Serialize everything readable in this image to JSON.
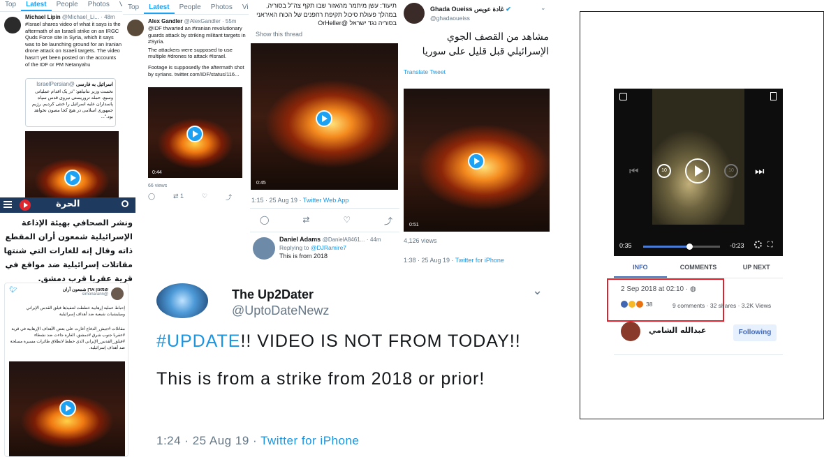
{
  "panel1": {
    "tabs": [
      "Top",
      "Latest",
      "People",
      "Photos",
      "Videos"
    ],
    "active_tab": "Latest",
    "author_name": "Michael Lipin",
    "author_handle": "@Michael_Li...",
    "time": "48m",
    "body": "#Israel shares video of what it says is the aftermath of an Israeli strike on an IRGC Quds Force site in Syria, which it says was to be launching ground for an Iranian drone attack on Israeli targets. The video hasn't yet been posted on the accounts of the IDF or PM Netanyahu",
    "quoted_name": "اسرائیل به فارسی",
    "quoted_handle": "@IsraelPersian",
    "quoted_body": "نخست وزیر نتانیاهو: \"در یک اقدام عملیاتی وسیع، حمله تروریستی نیروی قدس سپاه پاسداران علیه اسرائیل را خنثی کردیم. رژیم جمهوری اسلامی در هیچ کجا مصون نخواهد بود.\"..."
  },
  "panel2": {
    "tabs": [
      "Top",
      "Latest",
      "People",
      "Photos",
      "Videos"
    ],
    "active_tab": "Latest",
    "author_name": "Alex Gandler",
    "author_handle": "@AlexGandler",
    "time": "55m",
    "body_1": "@IDF thwarted an #iranian revolutionary guards attack by striking militant targets in #Syria.",
    "body_2": "The attackers were supposed to use multiple #drones to attack #Israel.",
    "body_3": "Footage is supposedly the aftermath shot by syrians. twitter.com/IDF/status/116...",
    "video_time": "0:44",
    "views": "66 views",
    "retweets": "1",
    "likes": ""
  },
  "panel3": {
    "hebrew_text": "תיעוד: עשן מיתמר מהאזור שבו תקף צה\"ל בסוריה, במהלך פעולת סיכול תקיפת רחפנים של הכוח האיראני בסוריה נגד ישראל @OrHeller",
    "show_thread": "Show this thread",
    "video_time": "0:45",
    "meta_time": "1:15 · 25 Aug 19 · ",
    "meta_source": "Twitter Web App",
    "reply_name": "Daniel Adams",
    "reply_handle": "@DanielA8461...",
    "reply_time": "44m",
    "replying_to_label": "Replying to ",
    "replying_to_handle": "@DJRamire7",
    "reply_body": "This is from 2018"
  },
  "panel4": {
    "author_name": "Ghada Oueiss",
    "author_name_ar": "غادة عويس",
    "author_handle": "@ghadaoueiss",
    "body_ar": "مشاهد من القصف الجوي الإسرائيلي قبل قليل على سوريا",
    "translate": "Translate Tweet",
    "video_time": "0:51",
    "views": "4,126 views",
    "meta_time": "1:38 · 25 Aug 19 · ",
    "meta_source": "Twitter for iPhone"
  },
  "panel5": {
    "logo": "الحرة",
    "article_ar": "ونشر الصحافي بهيئة الإذاعة الإسرائيلية شمعون أران المقطع ذاته وقال إنه للغارات التي شنتها مقاتلات إسرائيلية ضد مواقع في قرية عقربا قرب دمشق.",
    "embed_name": "שמעון ארן شمعون آران",
    "embed_handle": "@simonarann",
    "embed_body_1": "إحباط عملية إرهابية خططت لتنفيذها فيلق القدس الإيراني وميليشيات شيعية ضد أهداف إسرائيلية",
    "embed_body_2": "مقاتلات #جيش_الدفاع أغارت على بعض الأهداف الإرهابية في قرية #عقربا جنوب شرق #دمشق. الغارة جاءت ضد نشطاء #فيلق_القدس_الإيراني الذي خطط لانطلاق طائرات مسيرة مسلحة ضد أهداف إسرائيلية."
  },
  "panel6": {
    "author_name": "The Up2Dater",
    "author_handle": "@UptoDateNewz",
    "body_hashtag": "#UPDATE",
    "body_1": "!! VIDEO IS NOT FROM TODAY!!",
    "body_2": "This is from a strike from 2018 or prior!",
    "meta_time": "1:24 · 25 Aug 19 · ",
    "meta_source": "Twitter for iPhone"
  },
  "panel7": {
    "time_elapsed": "0:35",
    "time_remaining": "-0:23",
    "progress": 0.6,
    "tabs": [
      "INFO",
      "COMMENTS",
      "UP NEXT"
    ],
    "active_tab": "INFO",
    "date": "2 Sep 2018 at 02:10 · ",
    "reactions_count": "38",
    "comments": "9 comments",
    "shares": "32 shares",
    "views": "3.2K Views",
    "page_name": "عبدالله الشامي",
    "follow_label": "Following"
  },
  "colors": {
    "twitter_blue": "#1da1f2",
    "link_blue": "#1b95e0",
    "alhurra_red": "#e3262e",
    "alhurra_navy": "#1f3a5f",
    "highlight_red": "#e0202a",
    "facebook_blue": "#4267b2"
  }
}
